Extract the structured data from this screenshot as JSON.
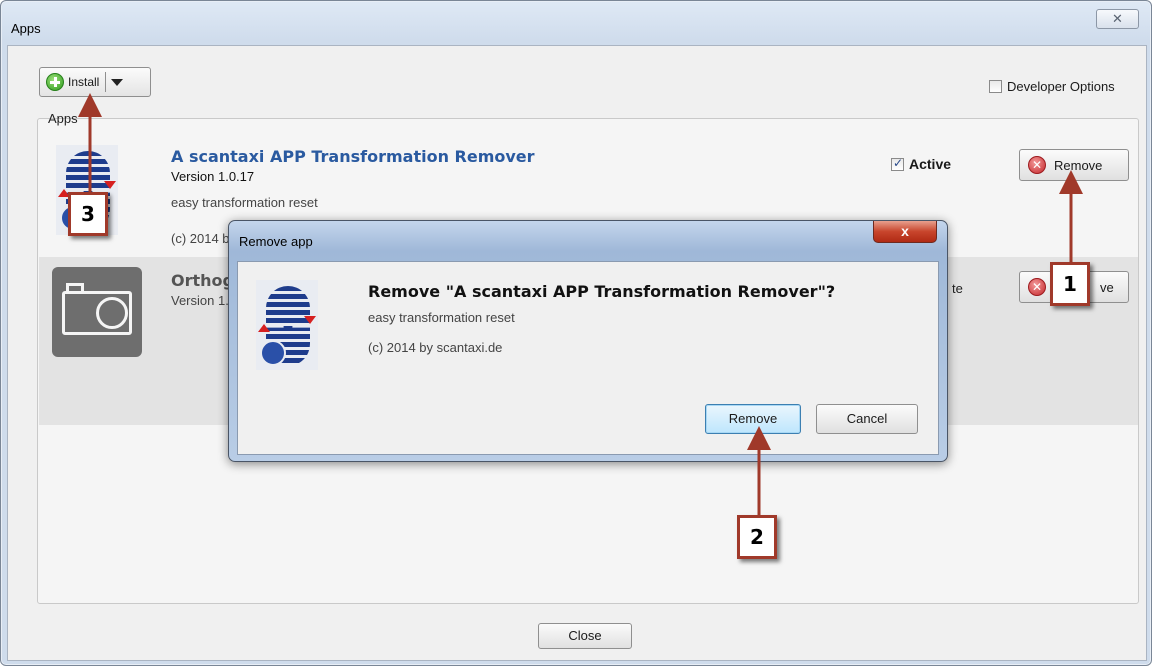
{
  "window": {
    "title": "Apps",
    "close_glyph": "✕"
  },
  "toolbar": {
    "install_label": "Install",
    "developer_options_label": "Developer Options",
    "developer_options_checked": false
  },
  "apps_group_label": "Apps",
  "apps": [
    {
      "name": "A scantaxi APP Transformation Remover",
      "version": "Version 1.0.17",
      "description": "easy transformation reset",
      "copyright": "(c) 2014 b",
      "active_label": "Active",
      "active_checked": true,
      "remove_label": "Remove",
      "icon": "scantaxi-s-logo"
    },
    {
      "name": "Orthog",
      "version": "Version 1.",
      "active_label_partial": "te",
      "remove_label_partial": "ve",
      "icon": "camera-icon"
    }
  ],
  "close_label": "Close",
  "dialog": {
    "title": "Remove app",
    "close_glyph": "x",
    "heading": "Remove \"A scantaxi APP Transformation Remover\"?",
    "description": "easy transformation reset",
    "copyright": "(c) 2014 by scantaxi.de",
    "remove_label": "Remove",
    "cancel_label": "Cancel"
  },
  "callouts": [
    "1",
    "2",
    "3"
  ],
  "colors": {
    "callout_border": "#a0392a",
    "app_name": "#2a5aa0",
    "remove_icon": "#c4262a",
    "install_icon": "#2e9a1c"
  }
}
